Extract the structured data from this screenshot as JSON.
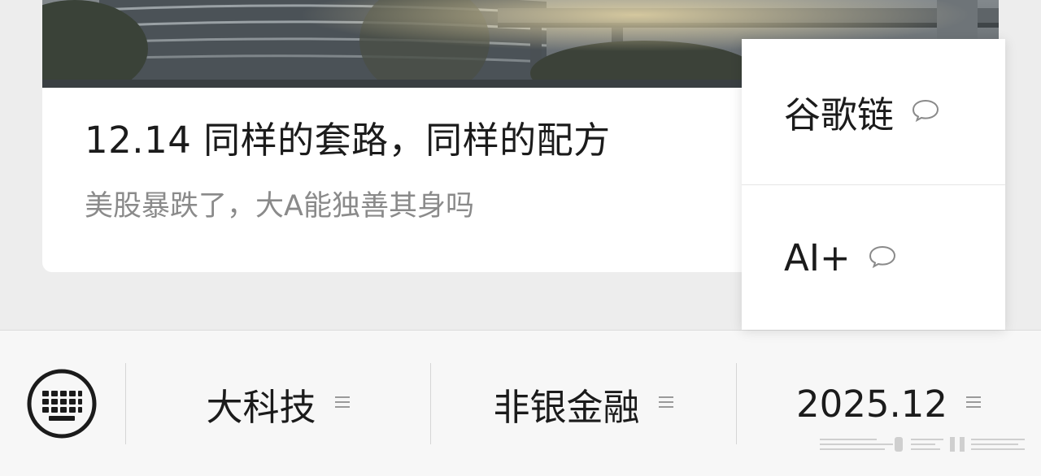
{
  "article": {
    "title": "12.14 同样的套路，同样的配方",
    "subtitle": "美股暴跌了，大A能独善其身吗"
  },
  "popup_menu": {
    "items": [
      {
        "label": "谷歌链",
        "icon": "comment-bubble-icon"
      },
      {
        "label": "AI+",
        "icon": "comment-bubble-icon"
      }
    ]
  },
  "menu_bar": {
    "keyboard_icon": "keyboard-icon",
    "items": [
      {
        "label": "大科技",
        "icon": "submenu-lines-icon"
      },
      {
        "label": "非银金融",
        "icon": "submenu-lines-icon"
      },
      {
        "label": "2025.12",
        "icon": "submenu-lines-icon"
      }
    ]
  },
  "colors": {
    "background": "#ededed",
    "card": "#ffffff",
    "title_text": "#1b1b1b",
    "subtitle_text": "#8a8a8a",
    "menubar": "#f7f7f7"
  }
}
